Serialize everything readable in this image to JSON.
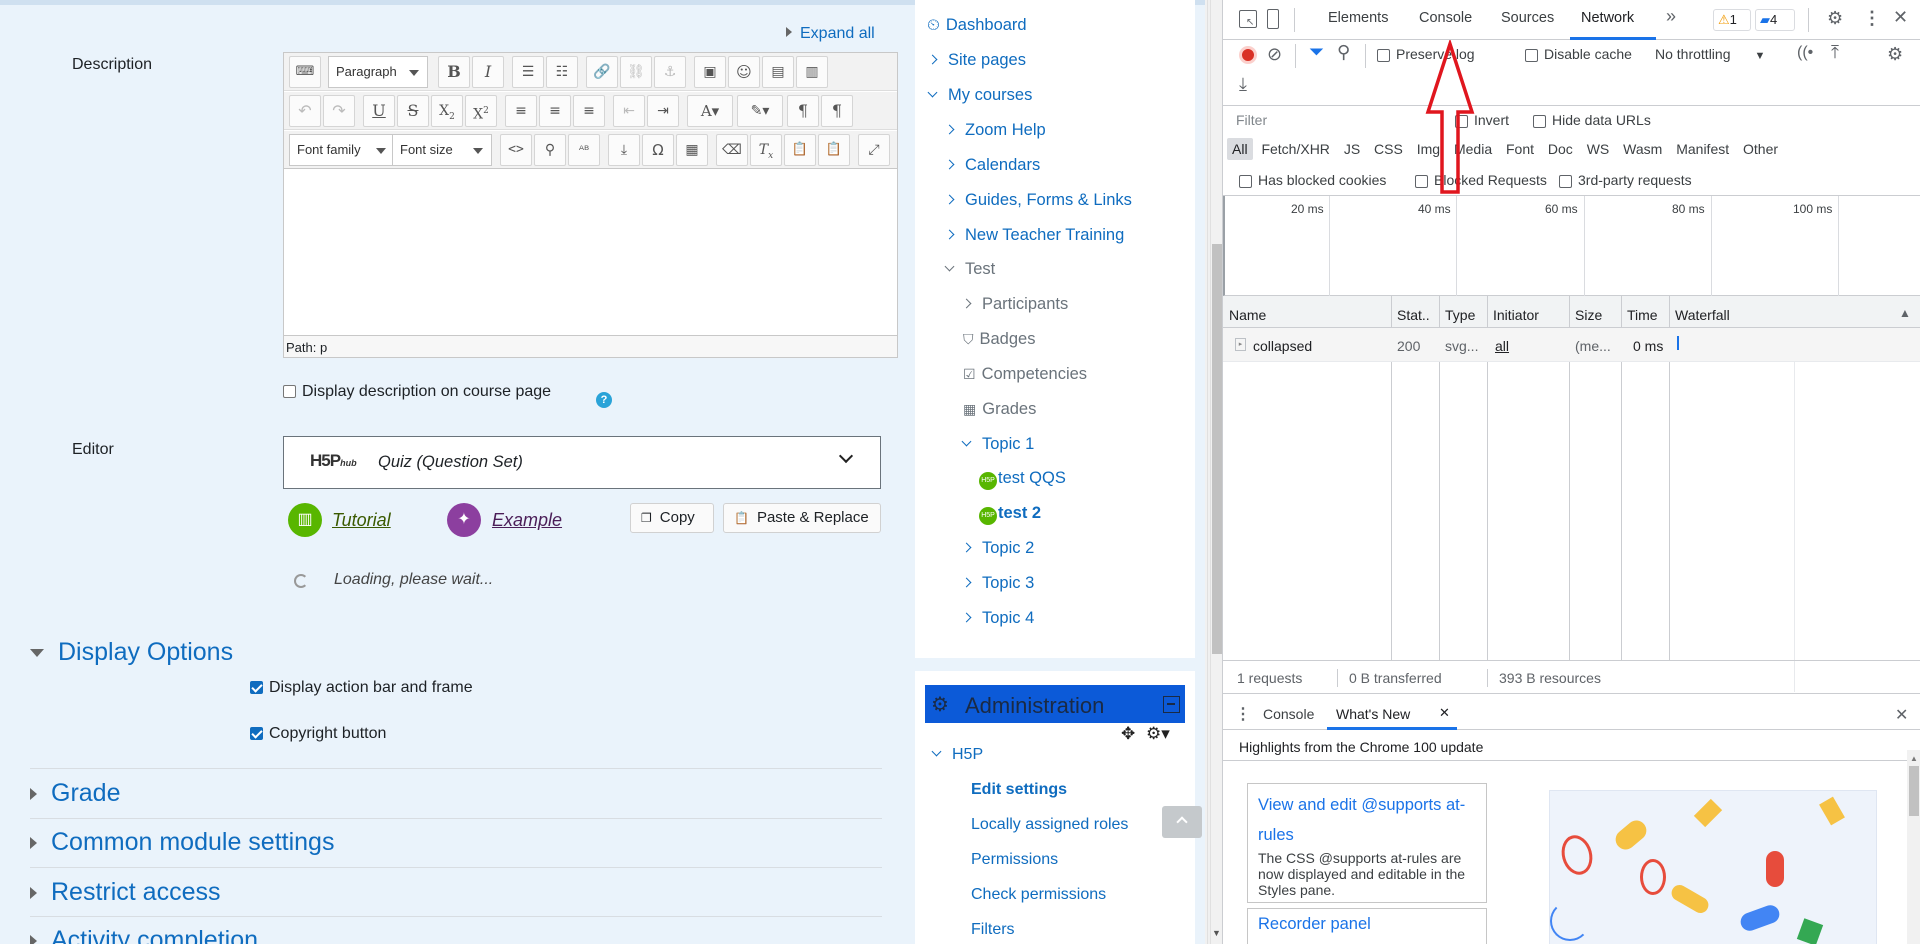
{
  "form": {
    "expand_all": "Expand all",
    "description_label": "Description",
    "editor": {
      "paragraph_select": "Paragraph",
      "font_family_select": "Font family",
      "font_size_select": "Font size",
      "path_text": "Path: p"
    },
    "display_description_label": "Display description on course page",
    "editor_label": "Editor",
    "content_type": {
      "brand": "H5P hub",
      "name": "Quiz (Question Set)"
    },
    "tutorial_link": "Tutorial",
    "example_link": "Example",
    "copy_button": "Copy",
    "paste_replace_button": "Paste & Replace",
    "loading_text": "Loading, please wait...",
    "display_options_heading": "Display Options",
    "display_action_bar_label": "Display action bar and frame",
    "copyright_button_label": "Copyright button",
    "sections": [
      "Grade",
      "Common module settings",
      "Restrict access",
      "Activity completion"
    ]
  },
  "nav": {
    "dashboard": "Dashboard",
    "site_pages": "Site pages",
    "my_courses": "My courses",
    "zoom_help": "Zoom Help",
    "calendars": "Calendars",
    "guides": "Guides, Forms & Links",
    "new_teacher": "New Teacher Training",
    "test": "Test",
    "participants": "Participants",
    "badges": "Badges",
    "competencies": "Competencies",
    "grades": "Grades",
    "topic1": "Topic 1",
    "test_qqs": "test QQS",
    "test2": "test 2",
    "topic2": "Topic 2",
    "topic3": "Topic 3",
    "topic4": "Topic 4"
  },
  "admin": {
    "title": "Administration",
    "h5p": "H5P",
    "edit_settings": "Edit settings",
    "locally_assigned": "Locally assigned roles",
    "permissions": "Permissions",
    "check_permissions": "Check permissions",
    "filters": "Filters"
  },
  "devtools": {
    "tabs": {
      "elements": "Elements",
      "console": "Console",
      "sources": "Sources",
      "network": "Network"
    },
    "warnings_count": "1",
    "messages_count": "4",
    "preserve_log": "Preserve log",
    "disable_cache": "Disable cache",
    "throttling": "No throttling",
    "filter_placeholder": "Filter",
    "invert": "Invert",
    "hide_data_urls": "Hide data URLs",
    "type_filters": [
      "All",
      "Fetch/XHR",
      "JS",
      "CSS",
      "Img",
      "Media",
      "Font",
      "Doc",
      "WS",
      "Wasm",
      "Manifest",
      "Other"
    ],
    "has_blocked_cookies": "Has blocked cookies",
    "blocked_requests": "Blocked Requests",
    "third_party": "3rd-party requests",
    "timeline_ticks": [
      "20 ms",
      "40 ms",
      "60 ms",
      "80 ms",
      "100 ms"
    ],
    "columns": {
      "name": "Name",
      "status": "Stat..",
      "type": "Type",
      "initiator": "Initiator",
      "size": "Size",
      "time": "Time",
      "waterfall": "Waterfall"
    },
    "row": {
      "name": "collapsed",
      "status": "200",
      "type": "svg...",
      "initiator": "all",
      "size": "(me...",
      "time": "0 ms"
    },
    "summary": {
      "requests": "1 requests",
      "transferred": "0 B transferred",
      "resources": "393 B resources"
    },
    "drawer_tabs": {
      "console": "Console",
      "whats_new": "What's New"
    },
    "highlights": "Highlights from the Chrome 100 update",
    "card1_title": "View and edit @supports at-rules",
    "card1_body": "The CSS @supports at-rules are now displayed and editable in the Styles pane.",
    "card2_title": "Recorder panel"
  },
  "colors": {
    "link_blue": "#0f6cbf",
    "admin_bar": "#0c5ad8",
    "arrow_red": "#e0161e"
  }
}
